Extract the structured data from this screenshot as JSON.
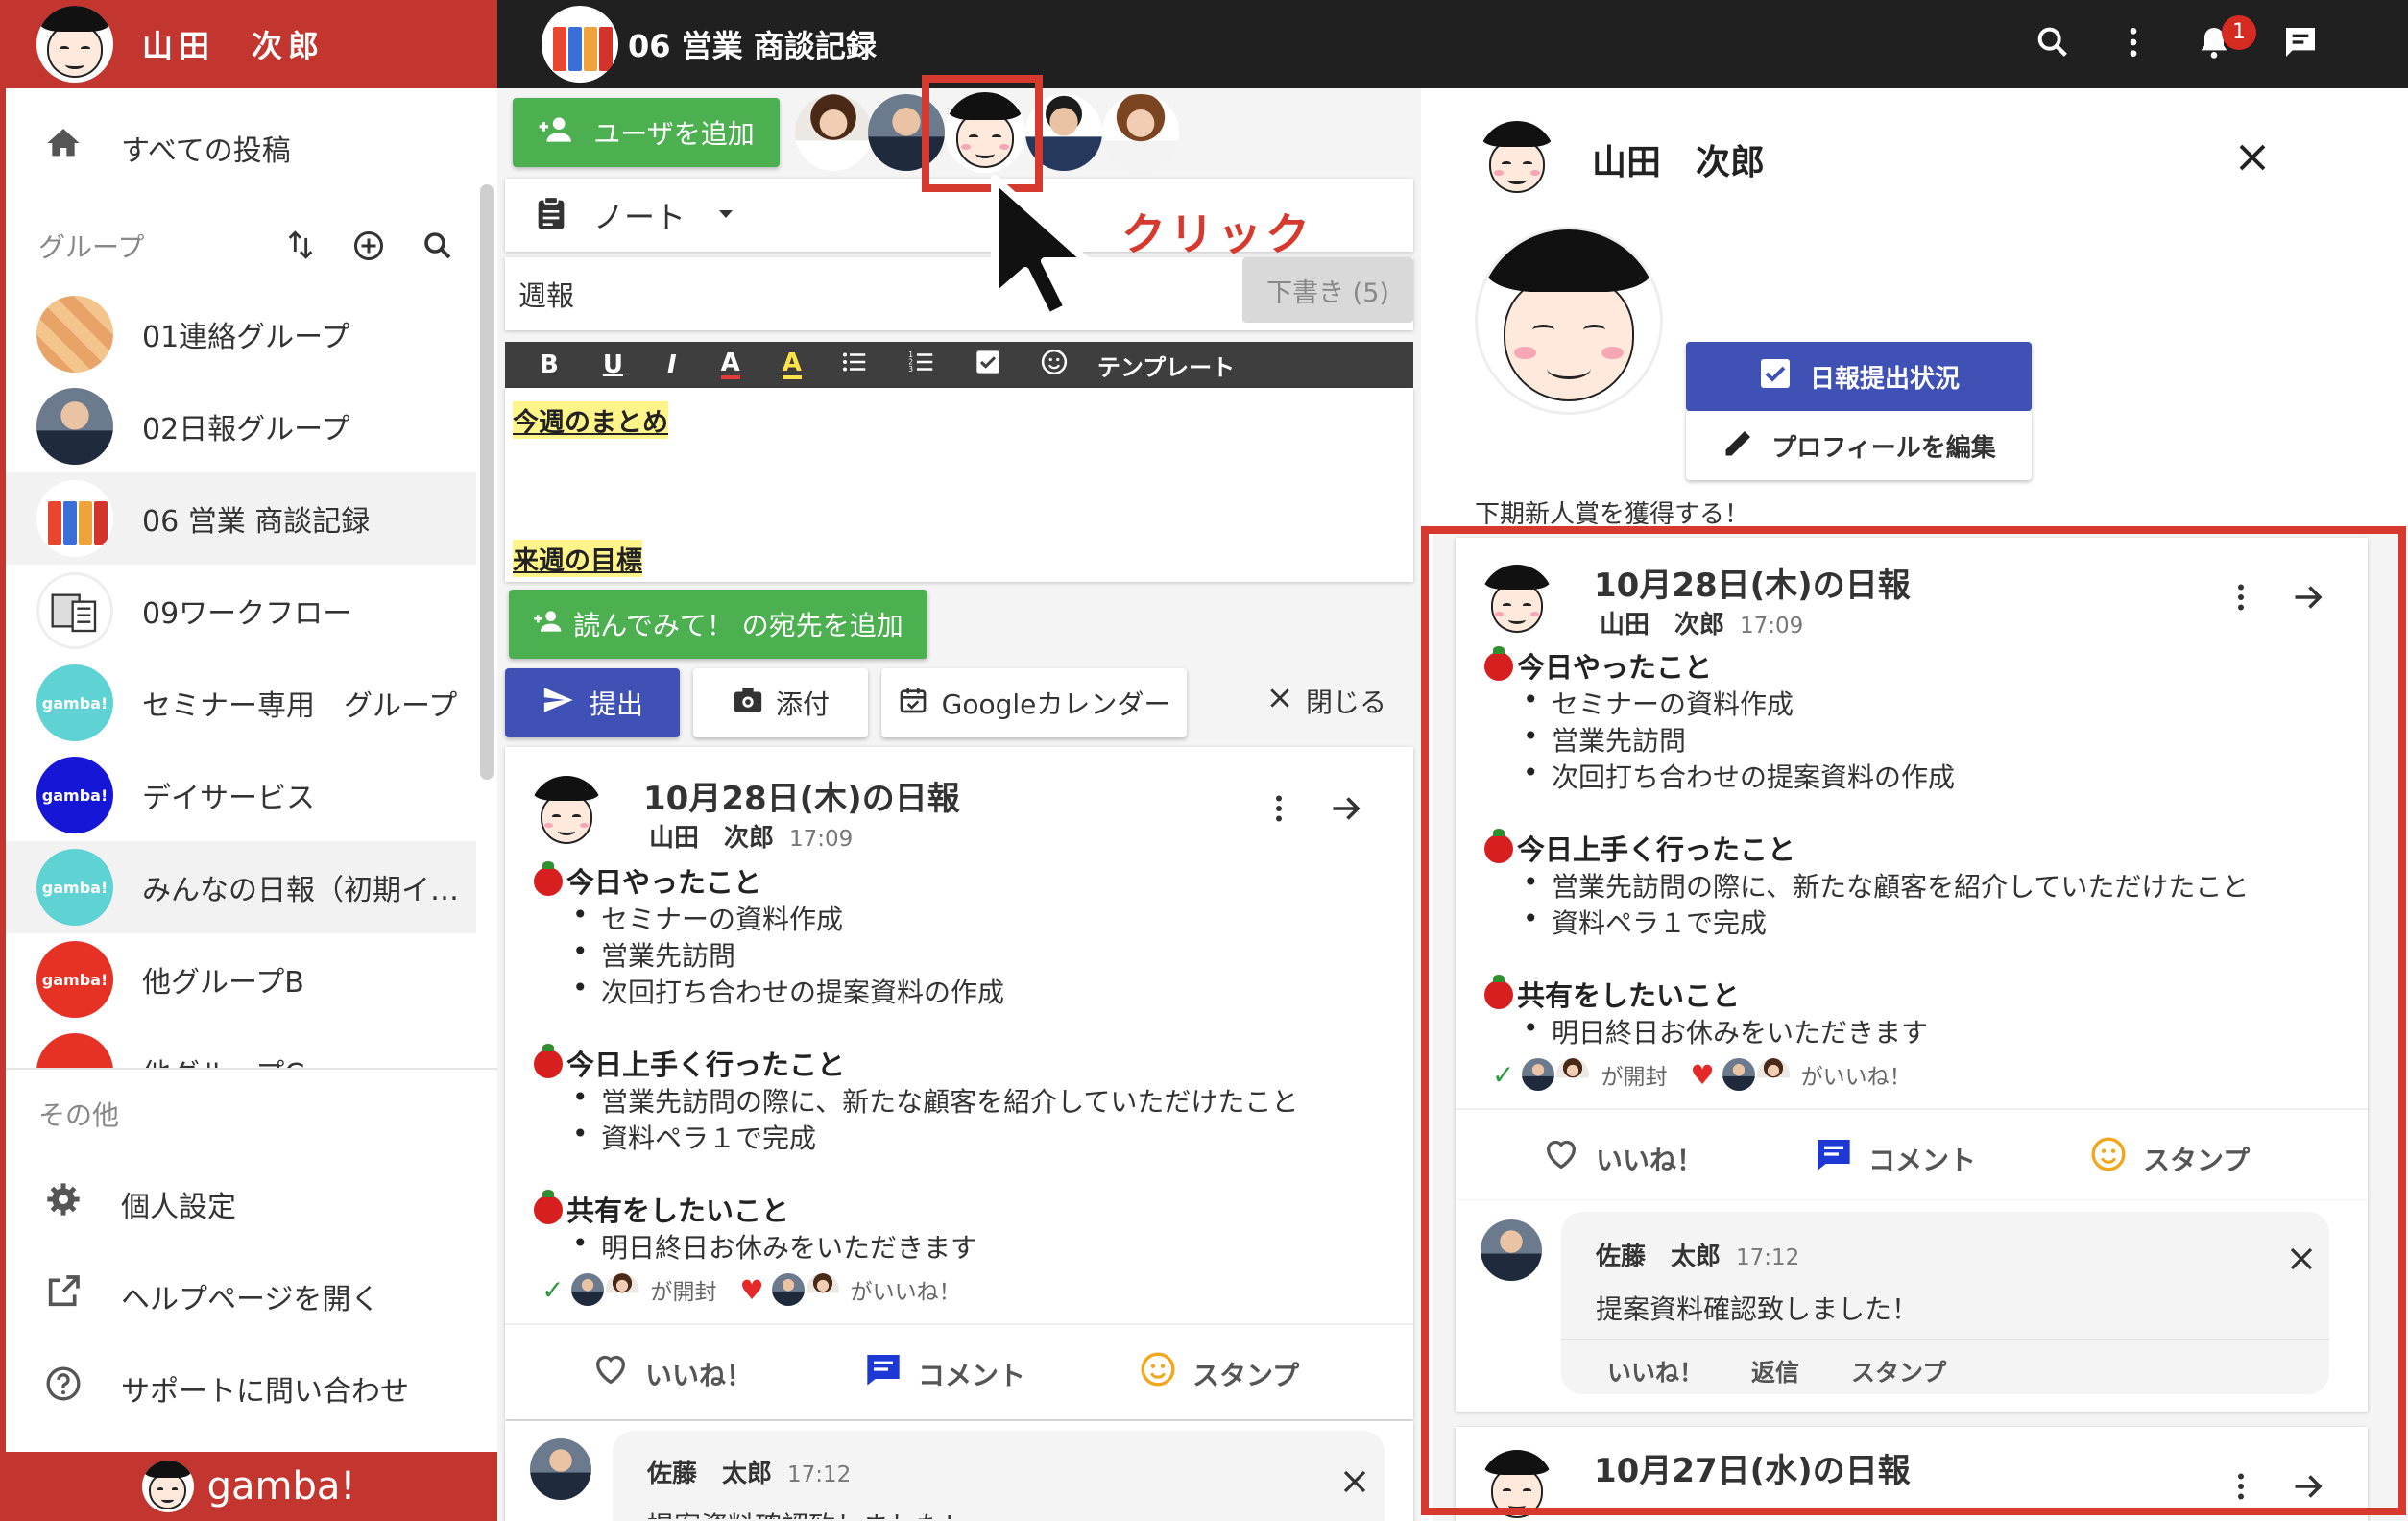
{
  "header": {
    "user_name": "山田　次郎",
    "group_title": "06 営業 商談記録",
    "notification_count": "1",
    "icons": [
      "search-icon",
      "more-vert-icon",
      "bell-icon",
      "chat-icon"
    ]
  },
  "sidebar": {
    "all_posts": "すべての投稿",
    "groups_heading": "グループ",
    "groups": [
      {
        "label": "01連絡グループ"
      },
      {
        "label": "02日報グループ"
      },
      {
        "label": "06 営業 商談記録"
      },
      {
        "label": "09ワークフロー"
      },
      {
        "label": "セミナー専用　グループ",
        "badge": "gamba!"
      },
      {
        "label": "デイサービス",
        "badge": "gamba!"
      },
      {
        "label": "みんなの日報（初期イメ…",
        "badge": "gamba!"
      },
      {
        "label": "他グループB",
        "badge": "gamba!"
      },
      {
        "label": "他グループC"
      }
    ],
    "other_heading": "その他",
    "settings": "個人設定",
    "help": "ヘルプページを開く",
    "support": "サポートに問い合わせ",
    "footer_brand": "gamba!"
  },
  "composer": {
    "add_user": "ユーザを追加",
    "note_type": "ノート",
    "title_value": "週報",
    "draft": "下書き (5)",
    "toolbar_template": "テンプレート",
    "body_heading1": "今週のまとめ",
    "body_heading2": "来週の目標",
    "add_reader": "読んでみて！ の宛先を追加",
    "submit": "提出",
    "attach": "添付",
    "calendar": "Googleカレンダー",
    "close": "閉じる"
  },
  "annotation": {
    "click_label": "クリック"
  },
  "post": {
    "title": "10月28日(木)の日報",
    "author": "山田　次郎",
    "time": "17:09",
    "section1": "今日やったこと",
    "items1": [
      "セミナーの資料作成",
      "営業先訪問",
      "次回打ち合わせの提案資料の作成"
    ],
    "section2": "今日上手く行ったこと",
    "items2": [
      "営業先訪問の際に、新たな顧客を紹介していただけたこと",
      "資料ペラ１で完成"
    ],
    "section3": "共有をしたいこと",
    "items3": [
      "明日終日お休みをいただきます"
    ],
    "opened": "が開封",
    "liked": "がいいね！",
    "like": "いいね！",
    "comment": "コメント",
    "stamp": "スタンプ"
  },
  "comment": {
    "author": "佐藤　太郎",
    "time": "17:12",
    "text": "提案資料確認致しました！",
    "like": "いいね！",
    "reply": "返信",
    "stamp": "スタンプ"
  },
  "profile": {
    "name": "山田　次郎",
    "report_status": "日報提出状況",
    "edit_profile": "プロフィールを編集",
    "goal": "下期新人賞を獲得する！",
    "next_post_title": "10月27日(水)の日報"
  },
  "colors": {
    "accent_red": "#c3362f",
    "dark_bar": "#202020",
    "green": "#4caf50",
    "indigo": "#3f51b5"
  }
}
